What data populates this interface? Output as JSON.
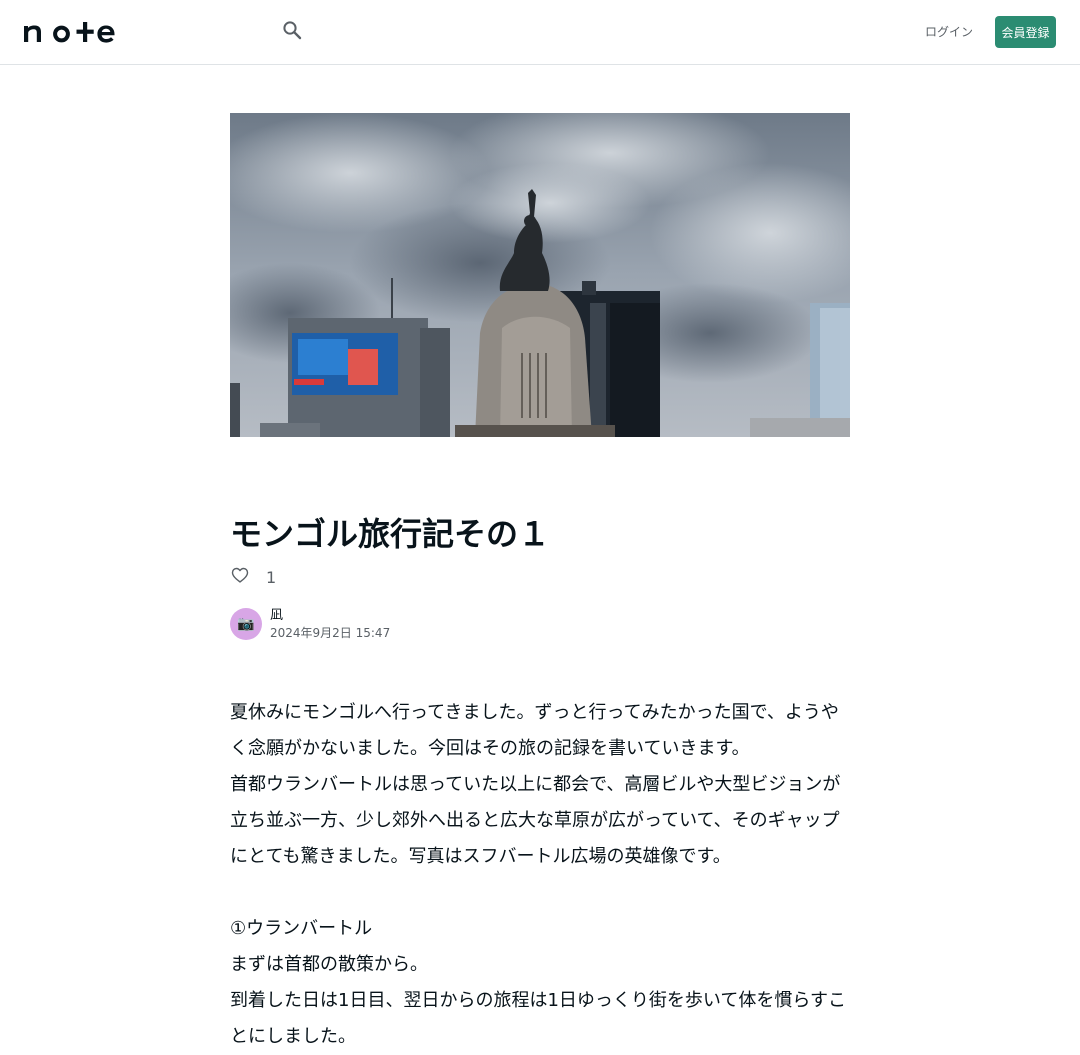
{
  "header": {
    "logo_text": "note",
    "search_icon": "search-icon",
    "login_label": "ログイン",
    "signup_label": "会員登録"
  },
  "article": {
    "title": "モンゴル旅行記その１",
    "like_count": "1",
    "author_name": "凪",
    "author_avatar_glyph": "📷",
    "date": "2024年9月2日 15:47",
    "paragraphs": [
      "夏休みにモンゴルへ行ってきました。ずっと行ってみたかった国で、ようやく念願がかないました。今回はその旅の記録を書いていきます。",
      "首都ウランバートルは思っていた以上に都会で、高層ビルや大型ビジョンが立ち並ぶ一方、少し郊外へ出ると広大な草原が広がっていて、そのギャップにとても驚きました。写真はスフバートル広場の英雄像です。",
      "",
      "①ウランバートル",
      "まずは首都の散策から。",
      "到着した日は1日目、翌日からの旅程は1日ゆっくり街を歩いて体を慣らすことにしました。"
    ]
  },
  "colors": {
    "accent": "#2b8c72",
    "border": "#dfe3e6",
    "text": "#08131a",
    "muted": "#5a6066",
    "avatar_bg": "#d8a6e6"
  }
}
